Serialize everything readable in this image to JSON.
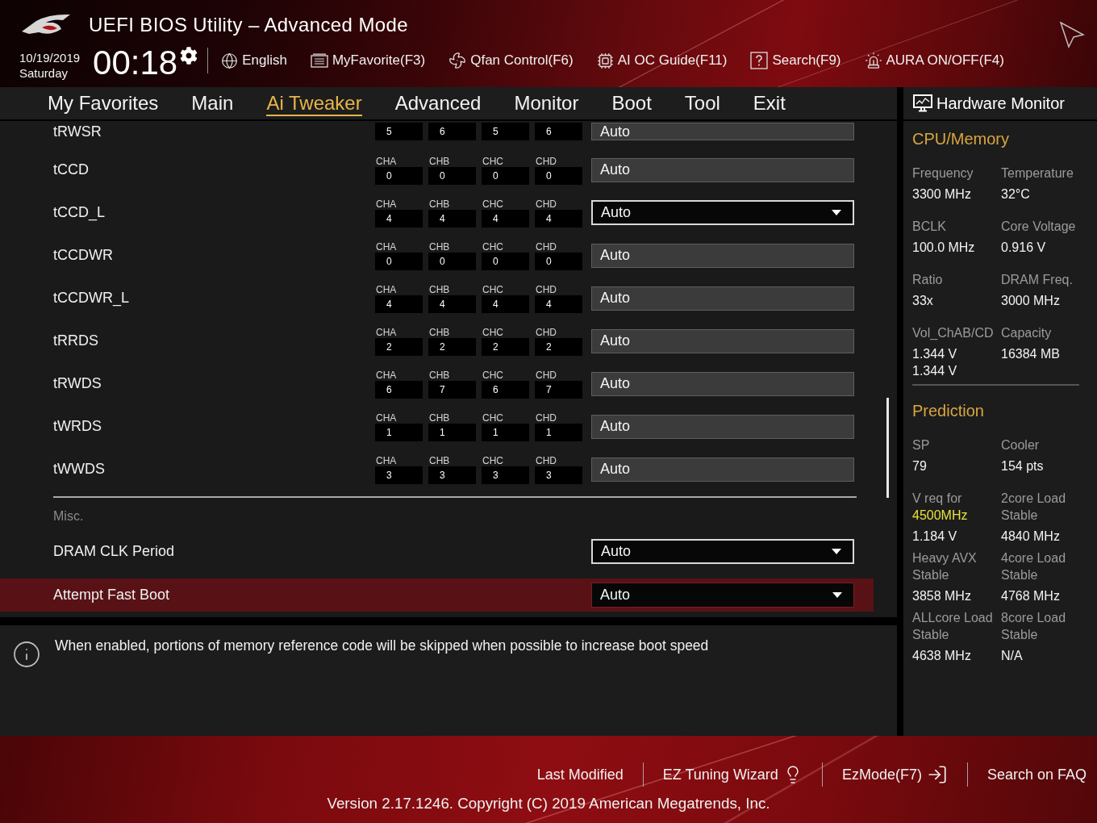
{
  "window": {
    "title": "UEFI BIOS Utility – Advanced Mode"
  },
  "clock": {
    "date": "10/19/2019",
    "day": "Saturday",
    "time": "00:18"
  },
  "toolbar": [
    {
      "label": "English"
    },
    {
      "label": "MyFavorite(F3)"
    },
    {
      "label": "Qfan Control(F6)"
    },
    {
      "label": "AI OC Guide(F11)"
    },
    {
      "label": "Search(F9)"
    },
    {
      "label": "AURA ON/OFF(F4)"
    }
  ],
  "tabs": [
    {
      "label": "My Favorites",
      "selected": false
    },
    {
      "label": "Main",
      "selected": false
    },
    {
      "label": "Ai Tweaker",
      "selected": true
    },
    {
      "label": "Advanced",
      "selected": false
    },
    {
      "label": "Monitor",
      "selected": false
    },
    {
      "label": "Boot",
      "selected": false
    },
    {
      "label": "Tool",
      "selected": false
    },
    {
      "label": "Exit",
      "selected": false
    }
  ],
  "timings": {
    "rows": [
      {
        "label": "tRWSR",
        "channels": [
          {
            "value": "5"
          },
          {
            "value": "6"
          },
          {
            "value": "5"
          },
          {
            "value": "6"
          }
        ],
        "value": "Auto",
        "kind": "fixed",
        "selected": false
      },
      {
        "label": "tCCD",
        "channels": [
          {
            "name": "CHA",
            "value": "0"
          },
          {
            "name": "CHB",
            "value": "0"
          },
          {
            "name": "CHC",
            "value": "0"
          },
          {
            "name": "CHD",
            "value": "0"
          }
        ],
        "value": "Auto",
        "kind": "fixed",
        "selected": false
      },
      {
        "label": "tCCD_L",
        "channels": [
          {
            "name": "CHA",
            "value": "4"
          },
          {
            "name": "CHB",
            "value": "4"
          },
          {
            "name": "CHC",
            "value": "4"
          },
          {
            "name": "CHD",
            "value": "4"
          }
        ],
        "value": "Auto",
        "kind": "select",
        "selected": false
      },
      {
        "label": "tCCDWR",
        "channels": [
          {
            "name": "CHA",
            "value": "0"
          },
          {
            "name": "CHB",
            "value": "0"
          },
          {
            "name": "CHC",
            "value": "0"
          },
          {
            "name": "CHD",
            "value": "0"
          }
        ],
        "value": "Auto",
        "kind": "fixed",
        "selected": false
      },
      {
        "label": "tCCDWR_L",
        "channels": [
          {
            "name": "CHA",
            "value": "4"
          },
          {
            "name": "CHB",
            "value": "4"
          },
          {
            "name": "CHC",
            "value": "4"
          },
          {
            "name": "CHD",
            "value": "4"
          }
        ],
        "value": "Auto",
        "kind": "fixed",
        "selected": false
      },
      {
        "label": "tRRDS",
        "channels": [
          {
            "name": "CHA",
            "value": "2"
          },
          {
            "name": "CHB",
            "value": "2"
          },
          {
            "name": "CHC",
            "value": "2"
          },
          {
            "name": "CHD",
            "value": "2"
          }
        ],
        "value": "Auto",
        "kind": "fixed",
        "selected": false
      },
      {
        "label": "tRWDS",
        "channels": [
          {
            "name": "CHA",
            "value": "6"
          },
          {
            "name": "CHB",
            "value": "7"
          },
          {
            "name": "CHC",
            "value": "6"
          },
          {
            "name": "CHD",
            "value": "7"
          }
        ],
        "value": "Auto",
        "kind": "fixed",
        "selected": false
      },
      {
        "label": "tWRDS",
        "channels": [
          {
            "name": "CHA",
            "value": "1"
          },
          {
            "name": "CHB",
            "value": "1"
          },
          {
            "name": "CHC",
            "value": "1"
          },
          {
            "name": "CHD",
            "value": "1"
          }
        ],
        "value": "Auto",
        "kind": "fixed",
        "selected": false
      },
      {
        "label": "tWWDS",
        "channels": [
          {
            "name": "CHA",
            "value": "3"
          },
          {
            "name": "CHB",
            "value": "3"
          },
          {
            "name": "CHC",
            "value": "3"
          },
          {
            "name": "CHD",
            "value": "3"
          }
        ],
        "value": "Auto",
        "kind": "fixed",
        "selected": false
      }
    ]
  },
  "misc": {
    "heading": "Misc.",
    "rows": [
      {
        "label": "DRAM CLK Period",
        "value": "Auto",
        "kind": "select",
        "selected": false
      },
      {
        "label": "Attempt Fast Boot",
        "value": "Auto",
        "kind": "select",
        "selected": true
      }
    ]
  },
  "help": {
    "text": "When enabled, portions of memory reference code will be skipped when possible to increase boot speed"
  },
  "hardware_monitor": {
    "title": "Hardware Monitor",
    "sections": [
      {
        "title": "CPU/Memory",
        "items": [
          {
            "label": "Frequency",
            "values": [
              "3300 MHz"
            ]
          },
          {
            "label": "Temperature",
            "values": [
              "32°C"
            ]
          },
          {
            "label": "BCLK",
            "values": [
              "100.0 MHz"
            ]
          },
          {
            "label": "Core Voltage",
            "values": [
              "0.916 V"
            ]
          },
          {
            "label": "Ratio",
            "values": [
              "33x"
            ]
          },
          {
            "label": "DRAM Freq.",
            "values": [
              "3000 MHz"
            ]
          },
          {
            "label": "Vol_ChAB/CD",
            "values": [
              "1.344 V",
              "1.344 V"
            ]
          },
          {
            "label": "Capacity",
            "values": [
              "16384 MB"
            ]
          }
        ]
      },
      {
        "title": "Prediction",
        "items": [
          {
            "label": "SP",
            "values": [
              "79"
            ]
          },
          {
            "label": "Cooler",
            "values": [
              "154 pts"
            ]
          },
          {
            "label": "V req for",
            "note": "4500MHz",
            "values": [
              "1.184 V"
            ]
          },
          {
            "label": "2core Load Stable",
            "values": [
              "4840 MHz"
            ]
          },
          {
            "label": "Heavy AVX Stable",
            "values": [
              "3858 MHz"
            ]
          },
          {
            "label": "4core Load Stable",
            "values": [
              "4768 MHz"
            ]
          },
          {
            "label": "ALLcore Load Stable",
            "values": [
              "4638 MHz"
            ]
          },
          {
            "label": "8core Load Stable",
            "values": [
              "N/A"
            ]
          }
        ]
      }
    ]
  },
  "footer": {
    "links": [
      {
        "label": "Last Modified"
      },
      {
        "label": "EZ Tuning Wizard"
      },
      {
        "label": "EzMode(F7)"
      },
      {
        "label": "Search on FAQ"
      }
    ],
    "copyright": "Version 2.17.1246. Copyright (C) 2019 American Megatrends, Inc."
  }
}
